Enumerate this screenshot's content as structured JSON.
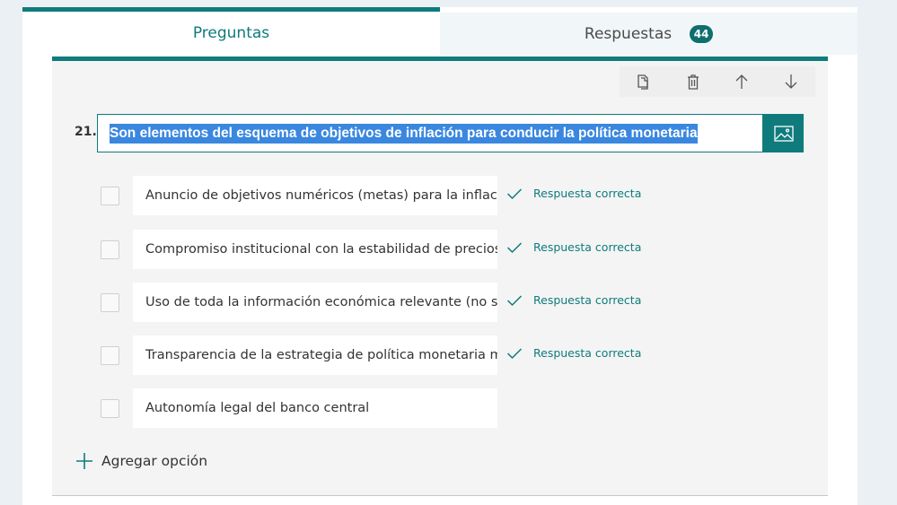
{
  "tabs": {
    "preguntas": "Preguntas",
    "respuestas": "Respuestas",
    "respuestas_count": "44"
  },
  "question": {
    "number": "21.",
    "text": "Son elementos del esquema de objetivos de inflación para conducir la política monetaria"
  },
  "options": [
    {
      "text": "Anuncio de objetivos numéricos (metas) para la inflación",
      "correct_label": "Respuesta correcta"
    },
    {
      "text": "Compromiso institucional con la estabilidad de precios como objetivo",
      "correct_label": "Respuesta correcta"
    },
    {
      "text": "Uso de toda la información económica relevante (no solo agregados)",
      "correct_label": "Respuesta correcta"
    },
    {
      "text": "Transparencia de la estrategia de política monetaria mediante comunicación",
      "correct_label": "Respuesta correcta"
    },
    {
      "text": "Autonomía legal del banco central",
      "correct_label": ""
    }
  ],
  "add_option": "Agregar opción",
  "colors": {
    "accent": "#0f7b7c",
    "selection": "#3a87e0"
  },
  "icons": [
    "copy-icon",
    "trash-icon",
    "arrow-up-icon",
    "arrow-down-icon",
    "image-icon",
    "check-icon",
    "plus-icon"
  ]
}
